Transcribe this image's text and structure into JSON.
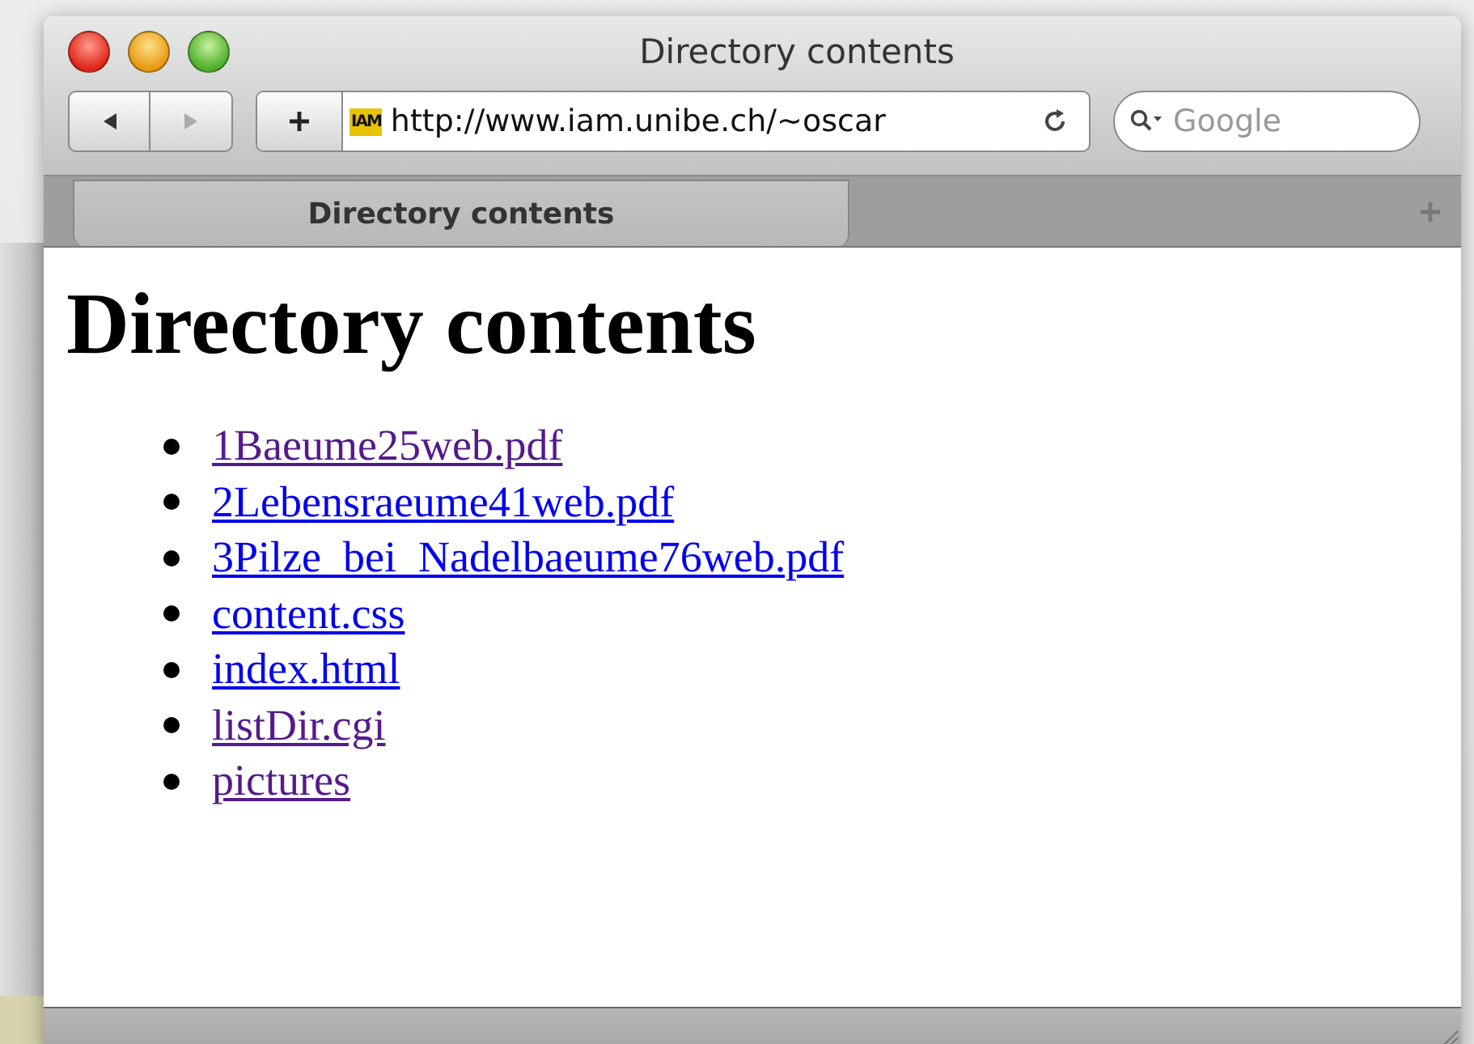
{
  "window": {
    "title": "Directory contents"
  },
  "toolbar": {
    "address": "http://www.iam.unibe.ch/~oscar",
    "search": {
      "placeholder": "Google"
    },
    "site_icon_text": "IAM"
  },
  "tabs": [
    {
      "label": "Directory contents",
      "selected": true
    }
  ],
  "page": {
    "heading": "Directory contents",
    "links": [
      {
        "text": "1Baeume25web.pdf",
        "visited": true
      },
      {
        "text": "2Lebensraeume41web.pdf",
        "visited": false
      },
      {
        "text": "3Pilze_bei_Nadelbaeume76web.pdf",
        "visited": false
      },
      {
        "text": "content.css",
        "visited": false
      },
      {
        "text": "index.html",
        "visited": false
      },
      {
        "text": "listDir.cgi",
        "visited": true
      },
      {
        "text": "pictures",
        "visited": true
      }
    ]
  }
}
